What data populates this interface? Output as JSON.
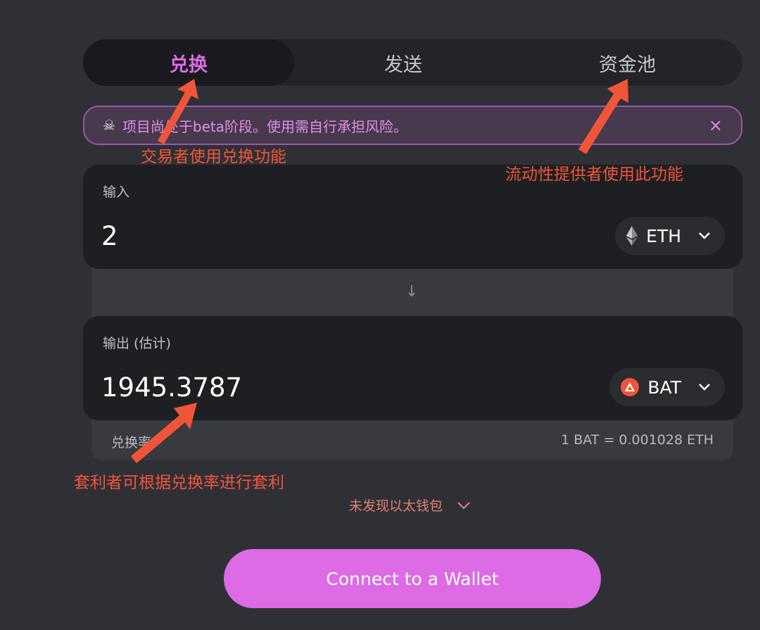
{
  "tabs": [
    {
      "label": "兑换",
      "active": true
    },
    {
      "label": "发送",
      "active": false
    },
    {
      "label": "资金池",
      "active": false
    }
  ],
  "banner": {
    "icon": "skull-icon",
    "text": "项目尚处于beta阶段。使用需自行承担风险。",
    "close": "×"
  },
  "input": {
    "label": "输入",
    "amount": "2",
    "token": "ETH",
    "token_icon": "eth-icon"
  },
  "swap_arrow": "↓",
  "output": {
    "label": "输出 (估计)",
    "amount": "1945.3787",
    "token": "BAT",
    "token_icon": "bat-icon"
  },
  "rate": {
    "label": "兑换率",
    "value": "1 BAT = 0.001028 ETH"
  },
  "wallet_hint": "未发现以太钱包",
  "connect_button": "Connect to a Wallet",
  "annotations": {
    "trader": "交易者使用兑换功能",
    "lp": "流动性提供者使用此功能",
    "arbitrage": "套利者可根据兑换率进行套利"
  },
  "colors": {
    "accent": "#dc6be5",
    "annotation": "#f0553a",
    "background": "#2f3035",
    "panel": "#1e1f22"
  }
}
